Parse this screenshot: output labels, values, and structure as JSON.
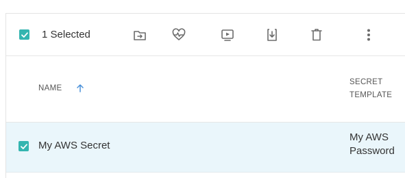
{
  "toolbar": {
    "selected_label": "1 Selected",
    "icons": [
      "move-to-folder-icon",
      "heartbeat-icon",
      "launch-icon",
      "export-icon",
      "delete-icon",
      "more-vertical-icon"
    ]
  },
  "table": {
    "columns": {
      "name": "NAME",
      "secret_template_line1": "SECRET",
      "secret_template_line2": "TEMPLATE"
    },
    "rows": [
      {
        "checked": true,
        "name": "My AWS Secret",
        "template_line1": "My AWS",
        "template_line2": "Password"
      }
    ]
  },
  "colors": {
    "accent": "#34b5b0",
    "icon_gray": "#6b6b6b",
    "selected_row_bg": "#eaf6fb",
    "sort_arrow": "#4a90d9"
  }
}
